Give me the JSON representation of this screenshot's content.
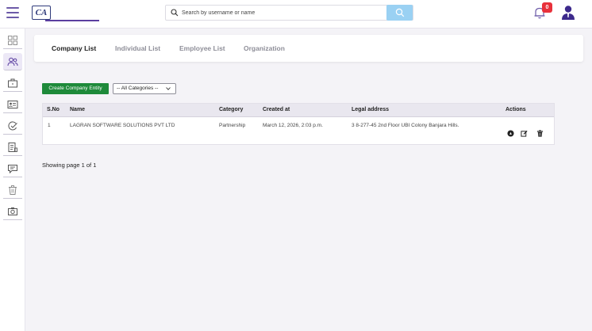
{
  "header": {
    "logo_text": "CA",
    "search": {
      "placeholder": "Search by username or name"
    },
    "notification_count": "0",
    "icons": [
      "menu-icon",
      "search-icon",
      "bell-icon",
      "user-avatar-icon"
    ]
  },
  "sidebar": {
    "items": [
      {
        "icon": "grid-icon"
      },
      {
        "icon": "users-icon",
        "active": true
      },
      {
        "icon": "briefcase-icon"
      },
      {
        "icon": "id-card-icon"
      },
      {
        "icon": "user-check-icon"
      },
      {
        "icon": "document-icon"
      },
      {
        "icon": "message-icon"
      },
      {
        "icon": "trash-icon"
      },
      {
        "icon": "camera-icon"
      }
    ]
  },
  "tabs": [
    {
      "label": "Company List",
      "active": true
    },
    {
      "label": "Individual List"
    },
    {
      "label": "Employee List"
    },
    {
      "label": "Organization"
    }
  ],
  "toolbar": {
    "create_label": "Create Company Entity",
    "category_selected": "-- All Categories --"
  },
  "table": {
    "columns": [
      "S.No",
      "Name",
      "Category",
      "Created at",
      "Legal address",
      "Actions"
    ],
    "rows": [
      {
        "sno": "1",
        "name": "LAGRAN SOFTWARE SOLUTIONS PVT LTD",
        "category": "Partnership",
        "created_at": "March 12, 2026, 2:03 p.m.",
        "legal_address": "3 8-277-45 2nd Floor UBI Colony Banjara Hills.",
        "actions": [
          "view-icon",
          "edit-icon",
          "delete-icon"
        ]
      }
    ]
  },
  "pagination": {
    "text": "Showing page 1 of 1"
  },
  "colors": {
    "accent": "#5b3fa0",
    "primary_button": "#1e8a3a",
    "search_button": "#9ad1f3",
    "badge": "#e8313b"
  }
}
